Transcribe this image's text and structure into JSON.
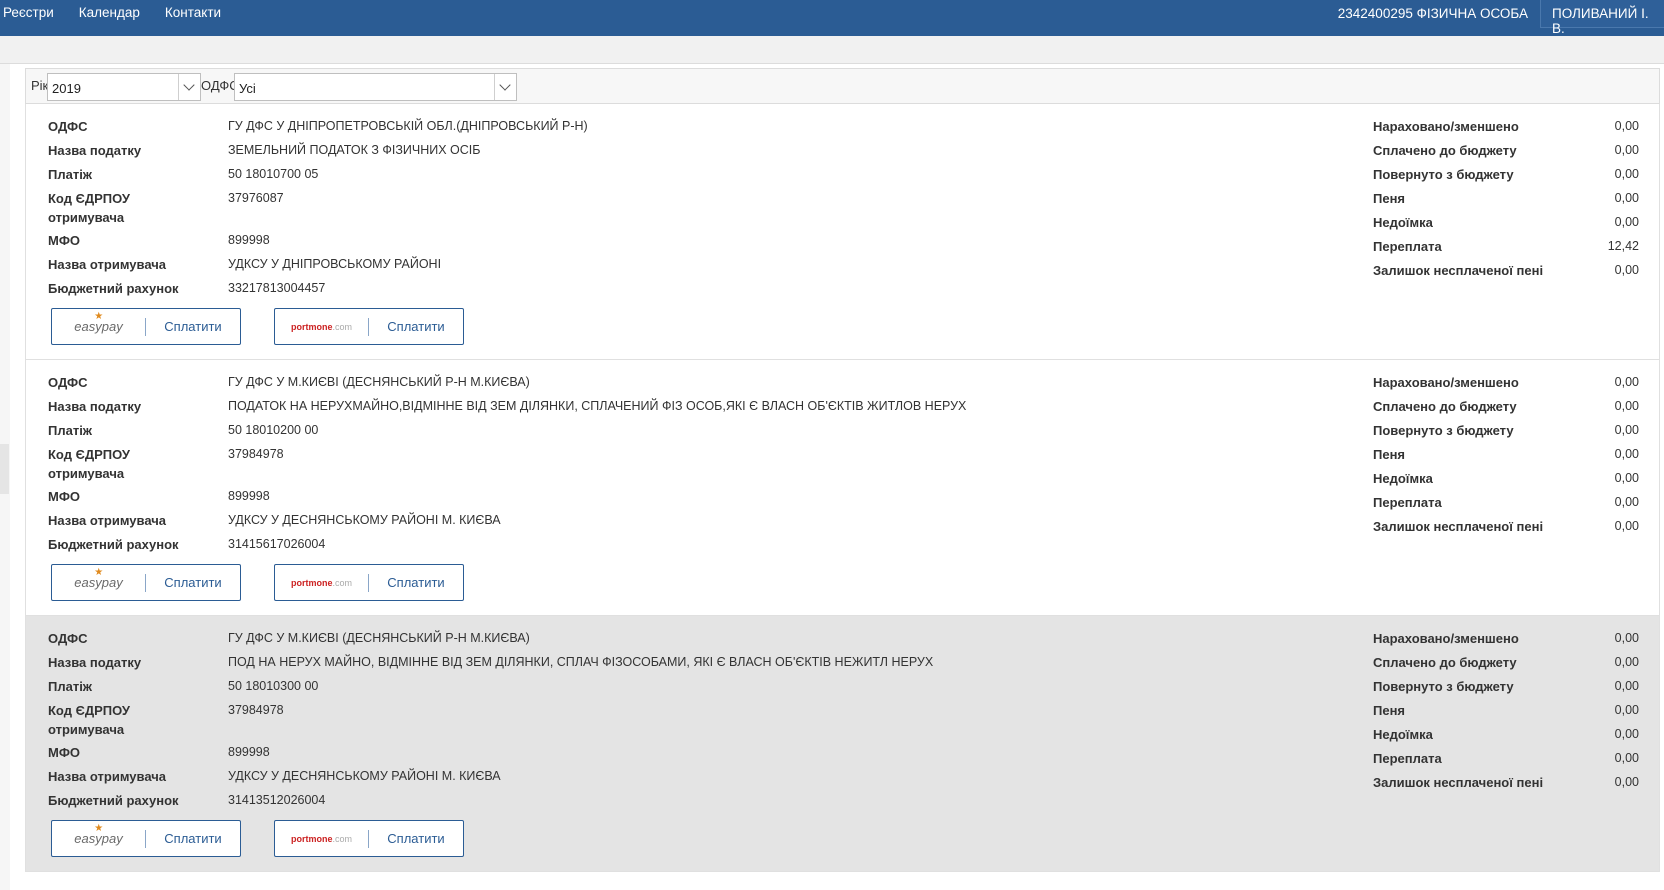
{
  "topbar": {
    "nav": [
      "Реєстри",
      "Календар",
      "Контакти"
    ],
    "account": "2342400295 ФІЗИЧНА ОСОБА",
    "user": "ПОЛИВАНИЙ І. В."
  },
  "filters": {
    "year_label": "Рік",
    "year_value": "2019",
    "odfs_label": "ОДФС",
    "odfs_value": "Усі"
  },
  "labels": {
    "odfs": "ОДФС",
    "tax_name": "Назва податку",
    "payment": "Платіж",
    "edrpou_line1": "Код ЄДРПОУ",
    "edrpou_line2": "отримувача",
    "mfo": "МФО",
    "recipient": "Назва отримувача",
    "budget_account": "Бюджетний рахунок",
    "accrued": "Нараховано/зменшено",
    "paid": "Сплачено до бюджету",
    "returned": "Повернуто з бюджету",
    "penalty": "Пеня",
    "arrears": "Недоїмка",
    "overpayment": "Переплата",
    "unpaid_penalty": "Залишок несплаченої пені",
    "pay": "Сплатити",
    "easypay_brand": "easypay",
    "portmone_brand": "portmone",
    "portmone_suffix": ".com"
  },
  "records": [
    {
      "odfs": "ГУ ДФС У ДНІПРОПЕТРОВСЬКІЙ ОБЛ.(ДНІПРОВСЬКИЙ Р-Н)",
      "tax_name": "ЗЕМЕЛЬНИЙ ПОДАТОК З ФІЗИЧНИХ ОСІБ",
      "payment": "50 18010700 05",
      "edrpou": "37976087",
      "mfo": "899998",
      "recipient": "УДКСУ У ДНІПРОВСЬКОМУ РАЙОНІ",
      "budget_account": "33217813004457",
      "accrued": "0,00",
      "paid": "0,00",
      "returned": "0,00",
      "penalty": "0,00",
      "arrears": "0,00",
      "overpayment": "12,42",
      "unpaid_penalty": "0,00"
    },
    {
      "odfs": "ГУ ДФС У М.КИЄВІ (ДЕСНЯНСЬКИЙ Р-Н М.КИЄВА)",
      "tax_name": "ПОДАТОК НА НЕРУХМАЙНО,ВІДМІННЕ ВІД ЗЕМ ДІЛЯНКИ, СПЛАЧЕНИЙ ФІЗ ОСОБ,ЯКІ Є ВЛАСН ОБ'ЄКТІВ ЖИТЛОВ НЕРУХ",
      "payment": "50 18010200 00",
      "edrpou": "37984978",
      "mfo": "899998",
      "recipient": "УДКСУ У ДЕСНЯНСЬКОМУ РАЙОНІ М. КИЄВА",
      "budget_account": "31415617026004",
      "accrued": "0,00",
      "paid": "0,00",
      "returned": "0,00",
      "penalty": "0,00",
      "arrears": "0,00",
      "overpayment": "0,00",
      "unpaid_penalty": "0,00"
    },
    {
      "odfs": "ГУ ДФС У М.КИЄВІ (ДЕСНЯНСЬКИЙ Р-Н М.КИЄВА)",
      "tax_name": "ПОД НА НЕРУХ МАЙНО, ВІДМІННЕ ВІД ЗЕМ ДІЛЯНКИ, СПЛАЧ ФІЗОСОБАМИ, ЯКІ Є ВЛАСН ОБ'ЄКТІВ НЕЖИТЛ НЕРУХ",
      "payment": "50 18010300 00",
      "edrpou": "37984978",
      "mfo": "899998",
      "recipient": "УДКСУ У ДЕСНЯНСЬКОМУ РАЙОНІ М. КИЄВА",
      "budget_account": "31413512026004",
      "accrued": "0,00",
      "paid": "0,00",
      "returned": "0,00",
      "penalty": "0,00",
      "arrears": "0,00",
      "overpayment": "0,00",
      "unpaid_penalty": "0,00"
    }
  ]
}
